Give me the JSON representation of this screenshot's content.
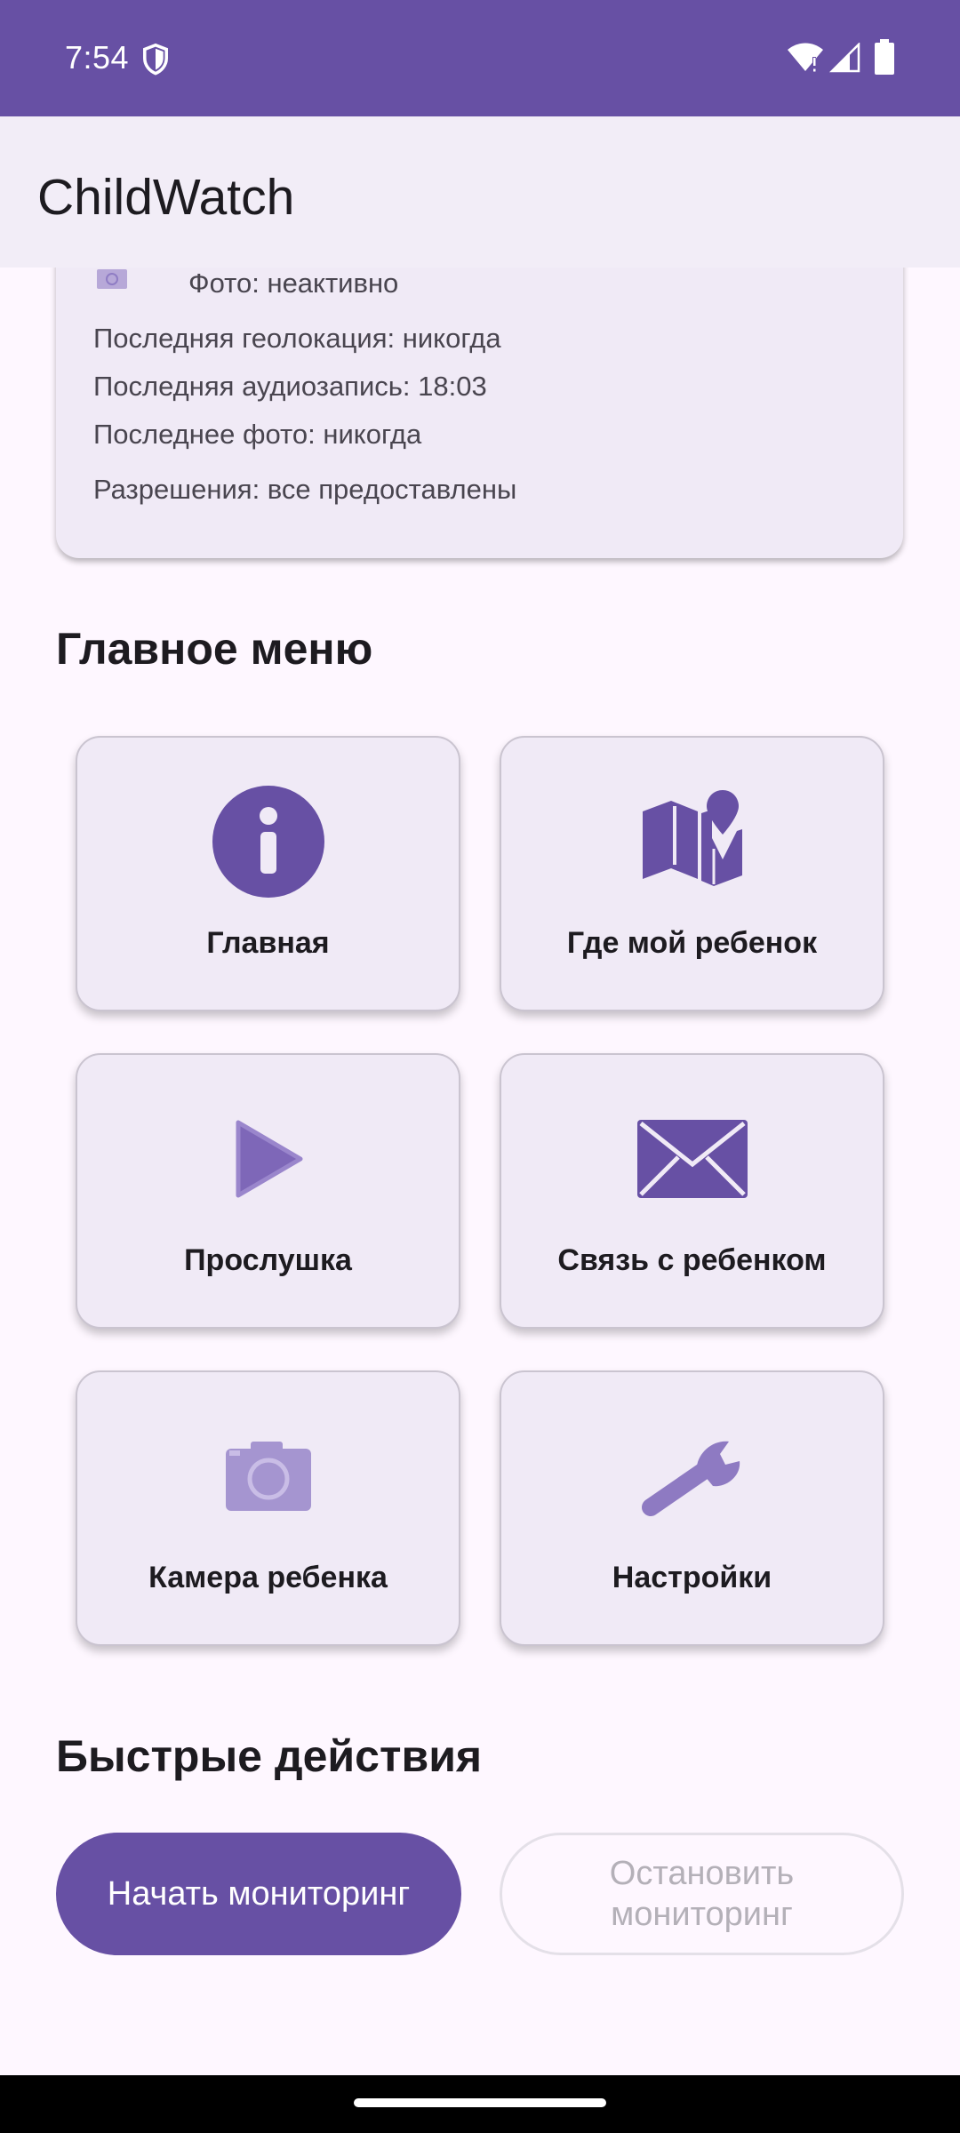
{
  "status_bar": {
    "time": "7:54",
    "icons": [
      "shield-icon",
      "wifi-icon",
      "signal-icon",
      "battery-icon"
    ]
  },
  "app_bar": {
    "title": "ChildWatch"
  },
  "status_card": {
    "photo_status": "Фото: неактивно",
    "last_location": "Последняя геолокация: никогда",
    "last_audio": "Последняя аудиозапись: 18:03",
    "last_photo": "Последнее фото: никогда",
    "permissions": "Разрешения: все предоставлены"
  },
  "main_menu": {
    "title": "Главное меню",
    "tiles": [
      {
        "label": "Главная",
        "icon": "info-icon"
      },
      {
        "label": "Где мой ребенок",
        "icon": "map-icon"
      },
      {
        "label": "Прослушка",
        "icon": "play-icon"
      },
      {
        "label": "Связь с ребенком",
        "icon": "mail-icon"
      },
      {
        "label": "Камера ребенка",
        "icon": "camera-icon"
      },
      {
        "label": "Настройки",
        "icon": "wrench-icon"
      }
    ]
  },
  "quick_actions": {
    "title": "Быстрые действия",
    "start_label": "Начать мониторинг",
    "stop_label": "Остановить мониторинг"
  },
  "colors": {
    "primary": "#6750A4",
    "surface": "#FEF7FF",
    "card": "#F0EAF6",
    "disabled_text": "#B4B0B8"
  }
}
